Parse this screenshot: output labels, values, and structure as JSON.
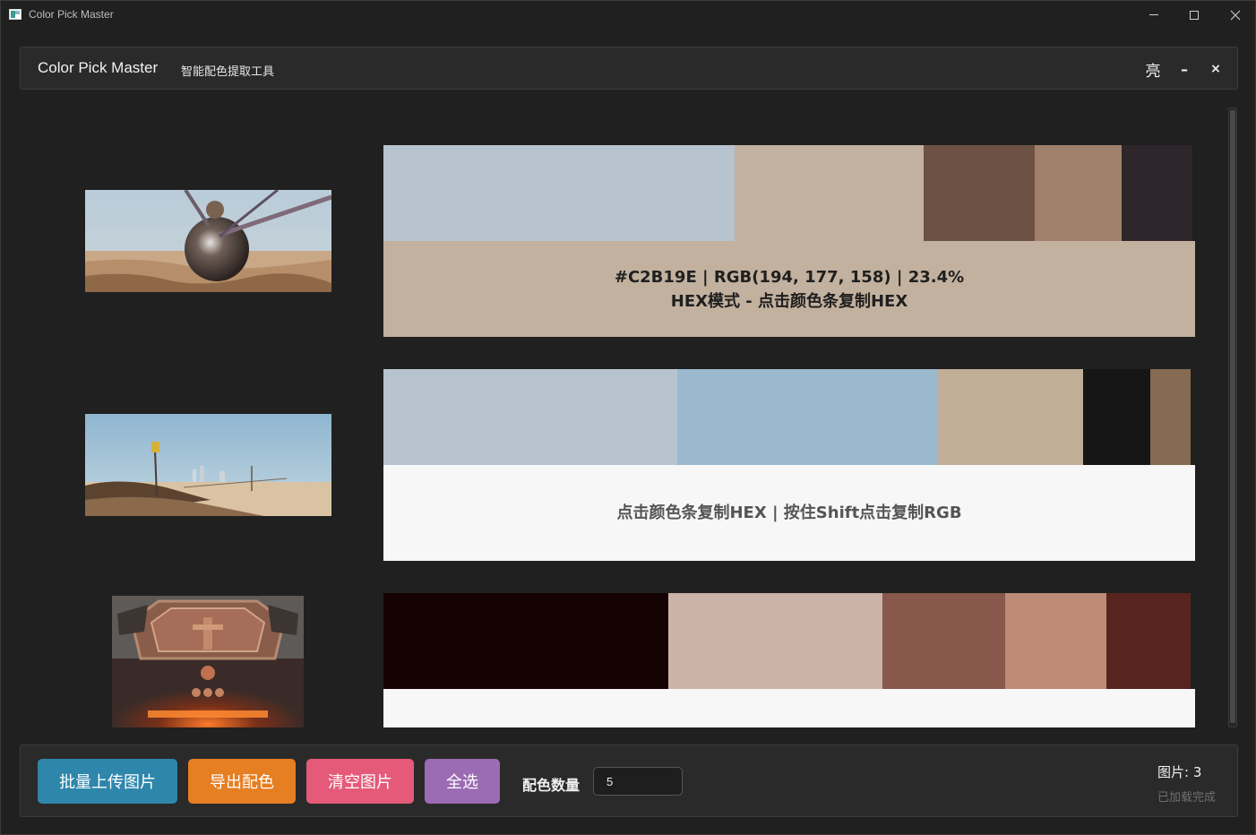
{
  "window": {
    "title": "Color Pick Master"
  },
  "header": {
    "title": "Color Pick Master",
    "subtitle": "智能配色提取工具",
    "theme_toggle_label": "亮",
    "minimize_label": "–",
    "close_label": "×"
  },
  "rows": [
    {
      "image_desc_icon": "sphere-desert-photo",
      "swatches": [
        {
          "hex": "#B7C3CF",
          "share": 0.434
        },
        {
          "hex": "#C2B19E",
          "share": 0.234
        },
        {
          "hex": "#6D5243",
          "share": 0.137
        },
        {
          "hex": "#A0806B",
          "share": 0.107
        },
        {
          "hex": "#2F262B",
          "share": 0.088
        }
      ],
      "info_bg": "#C2B19E",
      "info_color": "#1f1f1f",
      "info_line1": "#C2B19E | RGB(194, 177, 158) | 23.4%",
      "info_line2": "HEX模式 - 点击颜色条复制HEX"
    },
    {
      "image_desc_icon": "desert-city-photo",
      "swatches": [
        {
          "hex": "#B7C4CF",
          "share": 0.363
        },
        {
          "hex": "#9AB9CF",
          "share": 0.322
        },
        {
          "hex": "#C1AE97",
          "share": 0.179
        },
        {
          "hex": "#161616",
          "share": 0.083
        },
        {
          "hex": "#866A52",
          "share": 0.05
        }
      ],
      "info_bg": "#F7F7F7",
      "info_color": "#555555",
      "info_line1": "点击颜色条复制HEX | 按住Shift点击复制RGB",
      "info_line2": ""
    },
    {
      "image_desc_icon": "metal-panel-photo",
      "swatches": [
        {
          "hex": "#150202",
          "share": 0.352
        },
        {
          "hex": "#CBB3A8",
          "share": 0.265
        },
        {
          "hex": "#87584B",
          "share": 0.152
        },
        {
          "hex": "#BE8B77",
          "share": 0.125
        },
        {
          "hex": "#58241E",
          "share": 0.104
        }
      ],
      "info_bg": "#F7F7F7",
      "info_color": "#555555",
      "info_line1": "",
      "info_line2": ""
    }
  ],
  "footer": {
    "upload_label": "批量上传图片",
    "export_label": "导出配色",
    "clear_label": "清空图片",
    "select_all_label": "全选",
    "color_count_label": "配色数量",
    "color_count_value": "5",
    "image_count": "图片: 3",
    "load_status": "已加载完成"
  },
  "colors": {
    "upload": "#2E86AB",
    "export": "#E67E22",
    "clear": "#E45A78",
    "select_all": "#9B6BB3"
  }
}
